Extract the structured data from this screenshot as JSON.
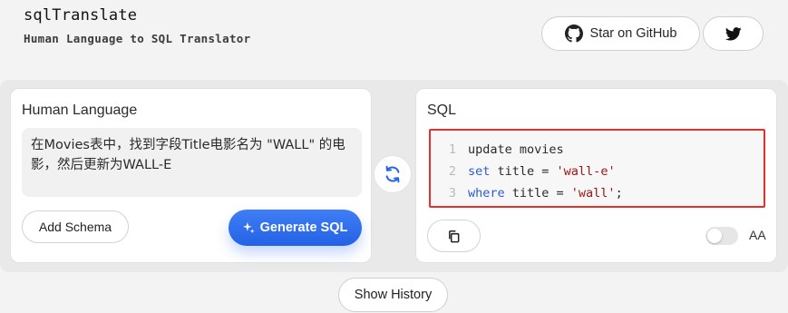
{
  "header": {
    "title": "sqlTranslate",
    "subtitle": "Human Language to SQL Translator",
    "github_label": "Star on GitHub",
    "github_icon": "github-icon",
    "twitter_icon": "twitter-icon"
  },
  "left_panel": {
    "label": "Human Language",
    "input_value": "在Movies表中，找到字段Title电影名为 \"WALL\" 的电影，然后更新为WALL-E",
    "add_schema_label": "Add Schema",
    "generate_label": "Generate SQL",
    "generate_icon": "sparkle-icon"
  },
  "swap": {
    "icon": "swap-icon"
  },
  "right_panel": {
    "label": "SQL",
    "code": [
      {
        "num": "1",
        "tokens": [
          {
            "text": "update movies",
            "kind": "plain"
          }
        ]
      },
      {
        "num": "2",
        "tokens": [
          {
            "text": "set",
            "kind": "kw"
          },
          {
            "text": " title = ",
            "kind": "plain"
          },
          {
            "text": "'wall-e'",
            "kind": "str"
          }
        ]
      },
      {
        "num": "3",
        "tokens": [
          {
            "text": "where",
            "kind": "kw"
          },
          {
            "text": " title = ",
            "kind": "plain"
          },
          {
            "text": "'wall'",
            "kind": "str"
          },
          {
            "text": ";",
            "kind": "plain"
          }
        ]
      }
    ],
    "copy_icon": "copy-icon",
    "toggle_on": false,
    "aa_label": "AA"
  },
  "footer": {
    "history_label": "Show History"
  },
  "colors": {
    "accent": "#2563eb",
    "highlight_border": "#e0312b",
    "keyword": "#2a5bd7",
    "string": "#a31515"
  }
}
